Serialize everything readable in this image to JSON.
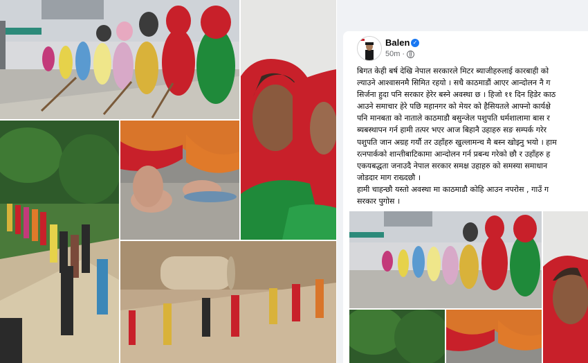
{
  "post": {
    "author": "Balen",
    "time": "50m",
    "lines": [
      "बिगत केही बर्ष देखि नेपाल सरकारले मिटर ब्याजीहरुलाई कारबाही को",
      "ल्याउने आश्वासनमै सिमित रहयो । सधै काठमाडौं आएर आन्दोलन नै ग",
      "सिर्जना हुदा पनि सरकार हेरेर बस्ने अवस्था छ । हिजो ११ दिन हिडेर काठ",
      "आउने समाचार हेरे पछि महानगर को मेयर को हैसियतले आफ्नो कार्यक्षे",
      "पनि मानबता को नाताले काठमाडौ बसुन्जेल पशुपति धर्मशालामा बास र",
      "ब्यबस्थापन गर्न हामी तत्पर भएर आज बिहानै उहाहरु सङ सम्पर्क गरेर",
      "पशुपति जान अग्रह गर्यौ तर उहाँहरु खुल्लामन्च मै बस्न खोझ्नु भयो । हाम",
      "रत्नपार्कको शान्तीबाटिकामा आन्दोलन गर्न प्रबन्ध गरेको छौ र उहाँहरु ह",
      "एकयबद्धता जनाउदै नेपाल सरकार समक्ष उहाहरु को समस्या समाधान",
      "जोडदार माग राख्दछौ ।",
      "हामी चाहन्छौ यस्तो अवस्था मा काठमाडौ कोहि आउन नपरोस , गाउँ ग",
      "सरकार पुगोस ।"
    ]
  },
  "icons": {
    "verified": "verified-badge-icon",
    "privacy": "globe-icon"
  },
  "colors": {
    "fb_background": "#f0f2f5",
    "verified_blue": "#1877f2",
    "saree_red": "#c8202a",
    "saree_green": "#1f8a3a",
    "saree_yellow": "#d9b23a"
  }
}
